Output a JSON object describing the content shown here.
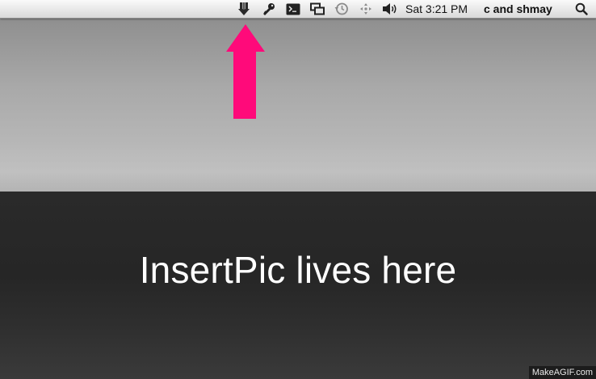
{
  "menubar": {
    "icons": [
      "insertpic-download-arrow-icon",
      "keychain-key-icon",
      "terminal-icon",
      "display-mirroring-icon",
      "time-machine-icon",
      "spaces-move-icon",
      "volume-icon"
    ],
    "clock": "Sat 3:21 PM",
    "user": "c and shmay",
    "spotlight_icon": "magnifier-icon"
  },
  "annotation": {
    "arrow_color": "#ff0a7a"
  },
  "caption": {
    "text": "InsertPic lives here"
  },
  "watermark": {
    "text": "MakeAGIF.com"
  }
}
